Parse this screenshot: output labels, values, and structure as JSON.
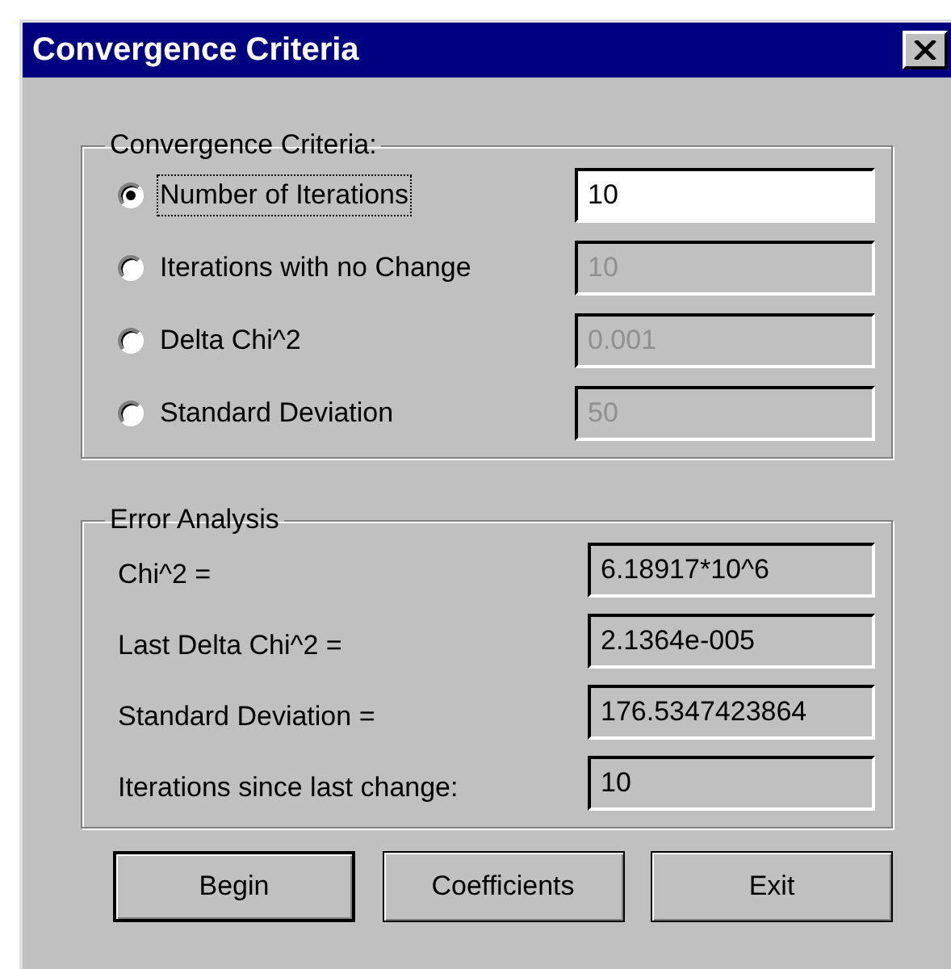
{
  "window": {
    "title": "Convergence Criteria"
  },
  "criteria": {
    "title": "Convergence Criteria:",
    "options": [
      {
        "label": "Number of Iterations",
        "selected": true,
        "focused": true,
        "value": "10",
        "disabled": false
      },
      {
        "label": "Iterations with no Change",
        "selected": false,
        "focused": false,
        "value": "10",
        "disabled": true
      },
      {
        "label": "Delta Chi^2",
        "selected": false,
        "focused": false,
        "value": "0.001",
        "disabled": true
      },
      {
        "label": "Standard Deviation",
        "selected": false,
        "focused": false,
        "value": "50",
        "disabled": true
      }
    ]
  },
  "error_analysis": {
    "title": "Error Analysis",
    "rows": [
      {
        "label": "Chi^2 =",
        "value": "6.18917*10^6"
      },
      {
        "label": "Last Delta Chi^2 =",
        "value": "2.1364e-005"
      },
      {
        "label": "Standard Deviation =",
        "value": "176.5347423864"
      },
      {
        "label": "Iterations since last change:",
        "value": "10"
      }
    ]
  },
  "buttons": [
    {
      "label": "Begin",
      "default": true
    },
    {
      "label": "Coefficients",
      "default": false
    },
    {
      "label": "Exit",
      "default": false
    }
  ]
}
